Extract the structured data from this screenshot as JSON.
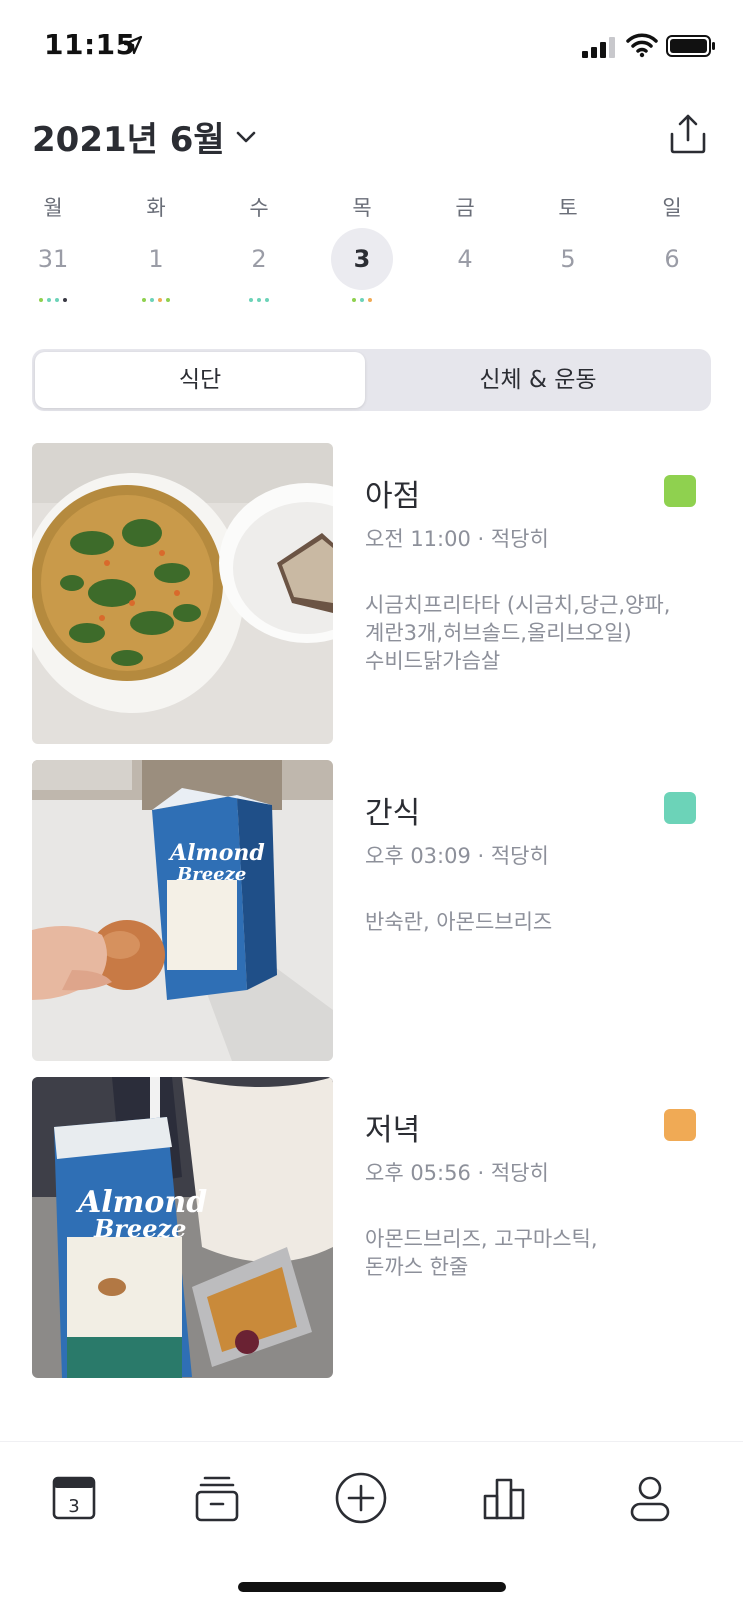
{
  "status_bar": {
    "time": "11:15"
  },
  "header": {
    "month": "2021년 6월"
  },
  "week": [
    {
      "name": "월",
      "num": "31",
      "dots": [
        "#8fd14f",
        "#6cd3b8",
        "#6cd3b8",
        "#3a3a44"
      ]
    },
    {
      "name": "화",
      "num": "1",
      "dots": [
        "#8fd14f",
        "#6cd3b8",
        "#f0aa55",
        "#8fd14f"
      ]
    },
    {
      "name": "수",
      "num": "2",
      "dots": [
        "#6cd3b8",
        "#6cd3b8",
        "#6cd3b8"
      ]
    },
    {
      "name": "목",
      "num": "3",
      "dots": [
        "#8fd14f",
        "#6cd3b8",
        "#f0aa55"
      ],
      "selected": true
    },
    {
      "name": "금",
      "num": "4",
      "dots": []
    },
    {
      "name": "토",
      "num": "5",
      "dots": []
    },
    {
      "name": "일",
      "num": "6",
      "dots": []
    }
  ],
  "tabs": {
    "diet": "식단",
    "body": "신체 & 운동"
  },
  "meals": [
    {
      "title": "아점",
      "subtitle": "오전 11:00 · 적당히",
      "description": "시금치프리타타 (시금치,당근,양파,\n계란3개,허브솔드,올리브오일)\n수비드닭가슴살",
      "color": "#8fd14f",
      "photo": "spinach-frittata-photo"
    },
    {
      "title": "간식",
      "subtitle": "오후 03:09 · 적당히",
      "description": "반숙란, 아몬드브리즈",
      "color": "#6cd3b8",
      "photo": "egg-almond-milk-photo"
    },
    {
      "title": "저녁",
      "subtitle": "오후 05:56 · 적당히",
      "description": "아몬드브리즈, 고구마스틱,\n돈까스 한줄",
      "color": "#f0aa55",
      "photo": "almond-milk-snack-photo"
    }
  ],
  "tabbar": {
    "calendar_day": "3"
  }
}
